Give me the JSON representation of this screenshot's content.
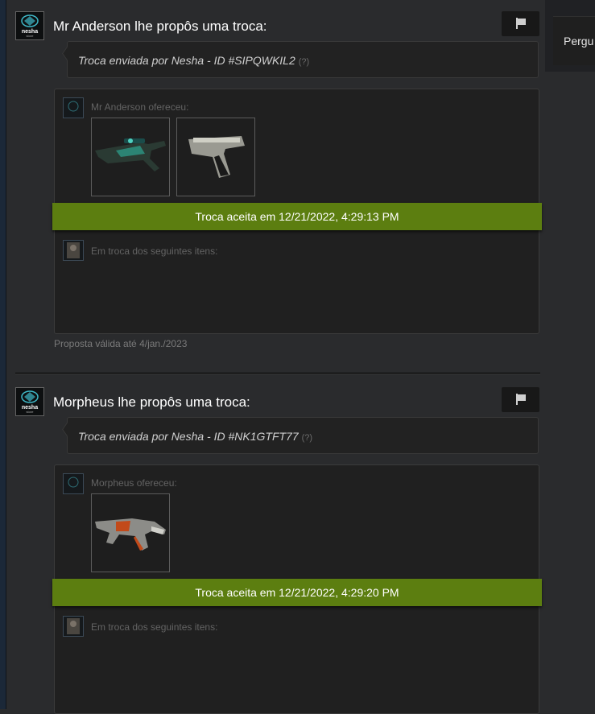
{
  "sidebar": {
    "label": "Pergu"
  },
  "offers": [
    {
      "title": "Mr Anderson lhe propôs uma troca:",
      "message": "Troca enviada por Nesha - ID #SIPQWKIL2",
      "help": "(?)",
      "offered_label": "Mr Anderson ofereceu:",
      "banner": "Troca aceita em 12/21/2022, 4:29:13 PM",
      "exchange_label": "Em troca dos seguintes itens:",
      "validity": "Proposta válida até 4/jan./2023"
    },
    {
      "title": "Morpheus lhe propôs uma troca:",
      "message": "Troca enviada por Nesha - ID #NK1GTFT77",
      "help": "(?)",
      "offered_label": "Morpheus ofereceu:",
      "banner": "Troca aceita em 12/21/2022, 4:29:20 PM",
      "exchange_label": "Em troca dos seguintes itens:"
    }
  ],
  "avatar_text": {
    "line1": "nesha",
    "line2": "store"
  },
  "colors": {
    "banner": "#5c7e10",
    "background": "#2a2b2d",
    "accent_logo": "#3fb8c7"
  }
}
